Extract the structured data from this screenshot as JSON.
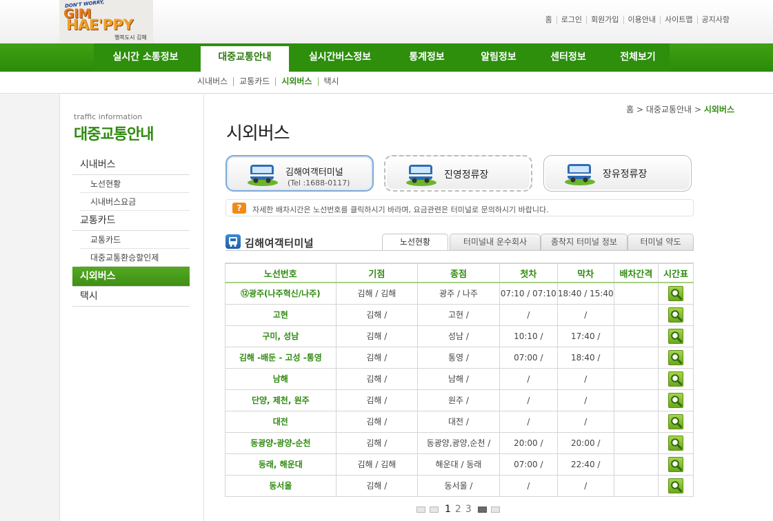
{
  "logo": {
    "tagline": "DON'T WORRY,",
    "line1": "GIM",
    "line2": "HAE'PPY",
    "sub": "행복도시 김해"
  },
  "util_links": [
    "홈",
    "로그인",
    "회원가입",
    "이용안내",
    "사이트맵",
    "공지사항"
  ],
  "gnb": [
    "실시간 소통정보",
    "대중교통안내",
    "실시간버스정보",
    "통계정보",
    "알림정보",
    "센터정보",
    "전체보기"
  ],
  "gnb_active": "대중교통안내",
  "snb": [
    "시내버스",
    "교통카드",
    "시외버스",
    "택시"
  ],
  "snb_active": "시외버스",
  "left_nav": {
    "en_title": "traffic information",
    "ko_title": "대중교통안내",
    "items": [
      {
        "label": "시내버스",
        "level": 1
      },
      {
        "label": "노선현황",
        "level": 2
      },
      {
        "label": "시내버스요금",
        "level": 2
      },
      {
        "label": "교통카드",
        "level": 1
      },
      {
        "label": "교통카드",
        "level": 2
      },
      {
        "label": "대중교통환승할인제",
        "level": 2
      },
      {
        "label": "시외버스",
        "level": 1,
        "active": true
      },
      {
        "label": "택시",
        "level": 1
      }
    ]
  },
  "breadcrumb": {
    "home": "홈",
    "sep": ">",
    "mid": "대중교통안내",
    "current": "시외버스"
  },
  "page_title": "시외버스",
  "terminals": [
    {
      "name": "김해여객터미널",
      "tel": "(Tel :1688-0117)",
      "active": true
    },
    {
      "name": "진영정류장",
      "tel": ""
    },
    {
      "name": "장유정류장",
      "tel": ""
    }
  ],
  "notice": {
    "icon": "?",
    "text": "자세한 배차시간은 노선번호를 클릭하시기 바라며, 요금관련은 터미널로 문의하시기 바랍니다."
  },
  "section_title": "김해여객터미널",
  "tabs": [
    "노선현황",
    "터미널내 운수회사",
    "종착지 터미널 정보",
    "터미널 약도"
  ],
  "tab_active": "노선현황",
  "table": {
    "headers": [
      "노선번호",
      "기점",
      "종점",
      "첫차",
      "막차",
      "배차간격",
      "시간표"
    ],
    "rows": [
      [
        "⑫광주(나주혁신/나주)",
        "김해 / 김해",
        "광주 / 나주",
        "07:10 / 07:10",
        "18:40 / 15:40",
        ""
      ],
      [
        "고현",
        "김해 /",
        "고현 /",
        "/",
        "/",
        ""
      ],
      [
        "구미, 성남",
        "김해 /",
        "성남 /",
        "10:10 /",
        "17:40 /",
        ""
      ],
      [
        "김해 -배둔 - 고성 -통영",
        "김해 /",
        "통영 /",
        "07:00 /",
        "18:40 /",
        ""
      ],
      [
        "남해",
        "김해 /",
        "남해 /",
        "/",
        "/",
        ""
      ],
      [
        "단양, 제천, 원주",
        "김해 /",
        "원주 /",
        "/",
        "/",
        ""
      ],
      [
        "대전",
        "김해 /",
        "대전 /",
        "/",
        "/",
        ""
      ],
      [
        "동광양-광양-순천",
        "김해 /",
        "동광양,광양,순천 /",
        "20:00 /",
        "20:00 /",
        ""
      ],
      [
        "동래, 해운대",
        "김해 / 김해",
        "해운대 / 동래",
        "07:00 /",
        "22:40 /",
        ""
      ],
      [
        "동서울",
        "김해 /",
        "동서울 /",
        "/",
        "/",
        ""
      ]
    ]
  },
  "pager": {
    "pages": [
      "1",
      "2",
      "3"
    ],
    "current": "1"
  },
  "colors": {
    "brand_green": "#2f8a10",
    "gnb_green": "#2d8f0c",
    "accent_orange": "#f08a18"
  }
}
